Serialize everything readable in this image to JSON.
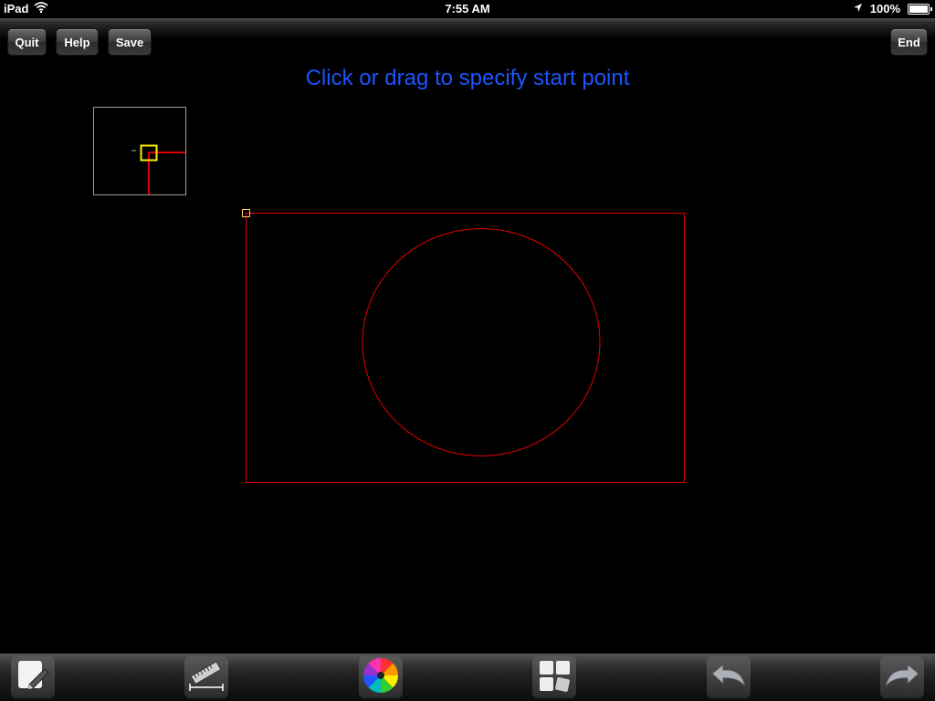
{
  "status_bar": {
    "device": "iPad",
    "time": "7:55 AM",
    "battery": "100%",
    "battery_level": 1.0
  },
  "toolbar": {
    "quit_label": "Quit",
    "help_label": "Help",
    "save_label": "Save",
    "end_label": "End"
  },
  "prompt": "Click or drag to specify start point",
  "colors": {
    "prompt": "#1a56ff",
    "geometry": "#e00000",
    "snap_marker": "#ffee00",
    "background": "#000000"
  },
  "bottom_tools": [
    {
      "name": "draw-tool",
      "icon": "pencil-icon"
    },
    {
      "name": "measure-tool",
      "icon": "ruler-icon"
    },
    {
      "name": "color-tool",
      "icon": "color-wheel-icon"
    },
    {
      "name": "layers-tool",
      "icon": "grid-icon"
    },
    {
      "name": "undo-tool",
      "icon": "undo-icon"
    },
    {
      "name": "redo-tool",
      "icon": "redo-icon"
    }
  ]
}
